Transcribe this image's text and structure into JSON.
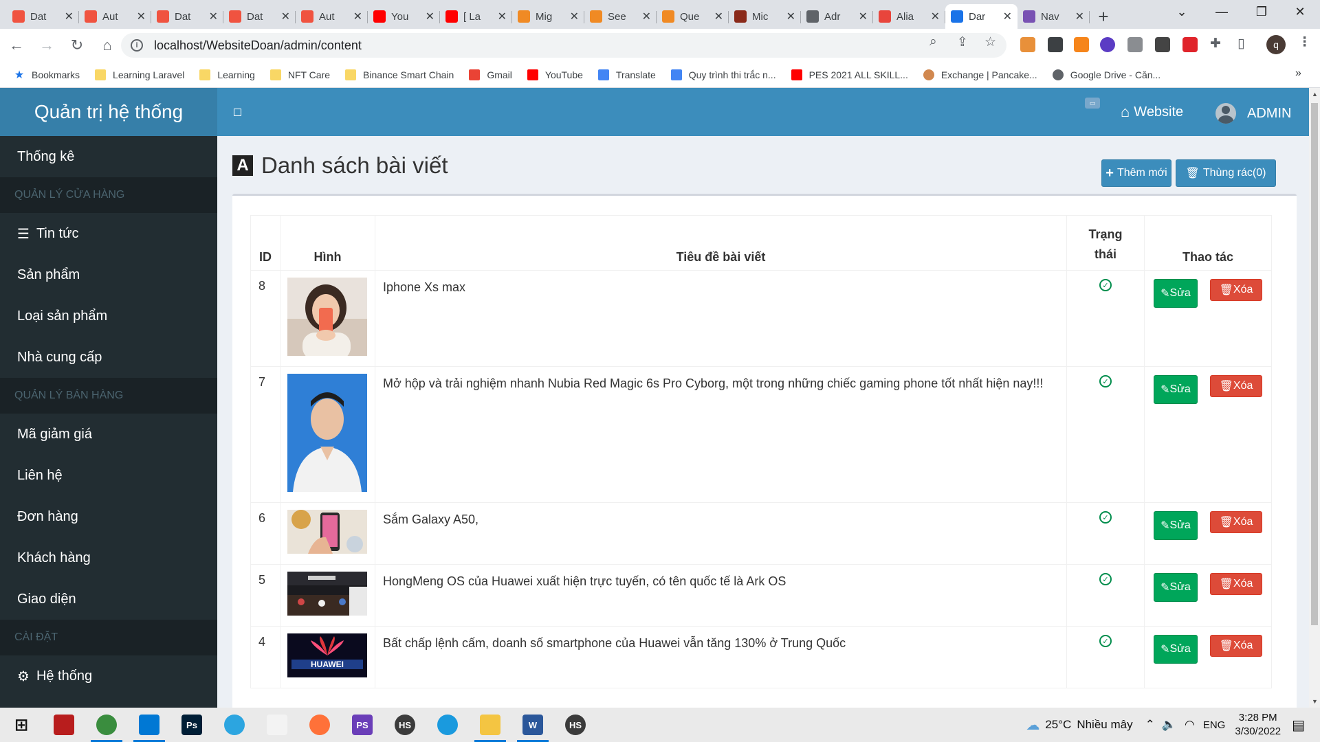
{
  "browser": {
    "tabs": [
      {
        "title": "Dat",
        "icon": "laravel-icon",
        "color": "#f05340"
      },
      {
        "title": "Aut",
        "icon": "laravel-icon",
        "color": "#f05340"
      },
      {
        "title": "Dat",
        "icon": "laravel-icon",
        "color": "#f05340"
      },
      {
        "title": "Dat",
        "icon": "laravel-icon",
        "color": "#f05340"
      },
      {
        "title": "Aut",
        "icon": "laravel-icon",
        "color": "#f05340"
      },
      {
        "title": "You",
        "icon": "youtube-icon",
        "color": "#ff0000"
      },
      {
        "title": "[ La",
        "icon": "youtube-icon",
        "color": "#ff0000"
      },
      {
        "title": "Mig",
        "icon": "cross-arrows-icon",
        "color": "#f08a24"
      },
      {
        "title": "See",
        "icon": "cross-arrows-icon",
        "color": "#f08a24"
      },
      {
        "title": "Que",
        "icon": "cross-arrows-icon",
        "color": "#f08a24"
      },
      {
        "title": "Mic",
        "icon": "avatar-icon",
        "color": "#8a2a1a"
      },
      {
        "title": "Adr",
        "icon": "globe-icon",
        "color": "#5f6368"
      },
      {
        "title": "Alia",
        "icon": "circle-logo-icon",
        "color": "#e8453c"
      },
      {
        "title": "Dar",
        "icon": "globe-icon",
        "color": "#1a73e8",
        "active": true
      },
      {
        "title": "Nav",
        "icon": "bootstrap-icon",
        "color": "#7952b3"
      }
    ],
    "url": "localhost/WebsiteDoan/admin/content",
    "bookmarks": [
      {
        "label": "Bookmarks",
        "icon": "star-icon"
      },
      {
        "label": "Learning Laravel",
        "icon": "folder-icon"
      },
      {
        "label": "Learning",
        "icon": "folder-icon"
      },
      {
        "label": "NFT Care",
        "icon": "folder-icon"
      },
      {
        "label": "Binance Smart Chain",
        "icon": "folder-icon"
      },
      {
        "label": "Gmail",
        "icon": "gmail-icon"
      },
      {
        "label": "YouTube",
        "icon": "youtube-icon"
      },
      {
        "label": "Translate",
        "icon": "translate-icon"
      },
      {
        "label": "Quy trình thi trắc n...",
        "icon": "docs-icon"
      },
      {
        "label": "PES 2021 ALL SKILL...",
        "icon": "youtube-icon"
      },
      {
        "label": "Exchange | Pancake...",
        "icon": "pancake-icon"
      },
      {
        "label": "Google Drive - Căn...",
        "icon": "globe-icon"
      }
    ],
    "profile_initial": "q"
  },
  "sidebar": {
    "brand": "Quản trị hệ thống",
    "items": [
      {
        "type": "item",
        "label": "Thống kê",
        "icon": ""
      },
      {
        "type": "header",
        "label": "QUẢN LÝ CỬA HÀNG"
      },
      {
        "type": "item",
        "label": "Tin tức",
        "icon": "list-icon"
      },
      {
        "type": "item",
        "label": "Sản phẩm",
        "icon": ""
      },
      {
        "type": "item",
        "label": "Loại sản phẩm",
        "icon": ""
      },
      {
        "type": "item",
        "label": "Nhà cung cấp",
        "icon": ""
      },
      {
        "type": "header",
        "label": "QUẢN LÝ BÁN HÀNG"
      },
      {
        "type": "item",
        "label": "Mã giảm giá",
        "icon": ""
      },
      {
        "type": "item",
        "label": "Liên hệ",
        "icon": ""
      },
      {
        "type": "item",
        "label": "Đơn hàng",
        "icon": ""
      },
      {
        "type": "item",
        "label": "Khách hàng",
        "icon": ""
      },
      {
        "type": "item",
        "label": "Giao diện",
        "icon": ""
      },
      {
        "type": "header",
        "label": "CÀI ĐẶT"
      },
      {
        "type": "item",
        "label": "Hệ thống",
        "icon": "gear-icon"
      }
    ]
  },
  "topnav": {
    "website_label": "Website",
    "admin_label": "ADMIN"
  },
  "main": {
    "title": "Danh sách bài viết",
    "title_icon_letter": "A",
    "add_button": "Thêm mới",
    "trash_button": "Thùng rác(0)",
    "table": {
      "headers": [
        "ID",
        "Hình",
        "Tiêu đề bài viết",
        "Trạng thái",
        "Thao tác"
      ],
      "edit_label": "Sửa",
      "delete_label": "Xóa",
      "rows": [
        {
          "id": "8",
          "title": "Iphone Xs max",
          "image": "woman-with-phone-photo",
          "status": "active"
        },
        {
          "id": "7",
          "title": "Mở hộp và trải nghiệm nhanh Nubia Red Magic 6s Pro Cyborg, một trong những chiếc gaming phone tốt nhất hiện nay!!!",
          "image": "man-portrait-photo",
          "status": "active"
        },
        {
          "id": "6",
          "title": "Sắm Galaxy A50,",
          "image": "hand-holding-phone-photo",
          "status": "active"
        },
        {
          "id": "5",
          "title": "HongMeng OS của Huawei xuất hiện trực tuyến, có tên quốc tế là Ark OS",
          "image": "huawei-store-photo",
          "status": "active"
        },
        {
          "id": "4",
          "title": "Bất chấp lệnh cấm, doanh số smartphone của Huawei vẫn tăng 130% ở Trung Quốc",
          "image": "huawei-logo-photo",
          "status": "active"
        }
      ]
    }
  },
  "taskbar": {
    "apps": [
      "start-icon",
      "game-icon",
      "chrome-icon",
      "vscode-icon",
      "photoshop-icon",
      "telegram-icon",
      "snipping-icon",
      "firefox-icon",
      "phpstorm-icon",
      "hs-icon",
      "edge-icon",
      "explorer-icon",
      "word-icon",
      "hs-icon"
    ],
    "weather_temp": "25°C",
    "weather_text": "Nhiều mây",
    "language": "ENG",
    "time": "3:28 PM",
    "date": "3/30/2022"
  },
  "colors": {
    "sidebar_bg": "#222d32",
    "brand_bg": "#367fa9",
    "navbar_bg": "#3c8dbc",
    "edit_btn": "#00a65a",
    "delete_btn": "#dd4b39",
    "status_ok": "#008d4c"
  }
}
